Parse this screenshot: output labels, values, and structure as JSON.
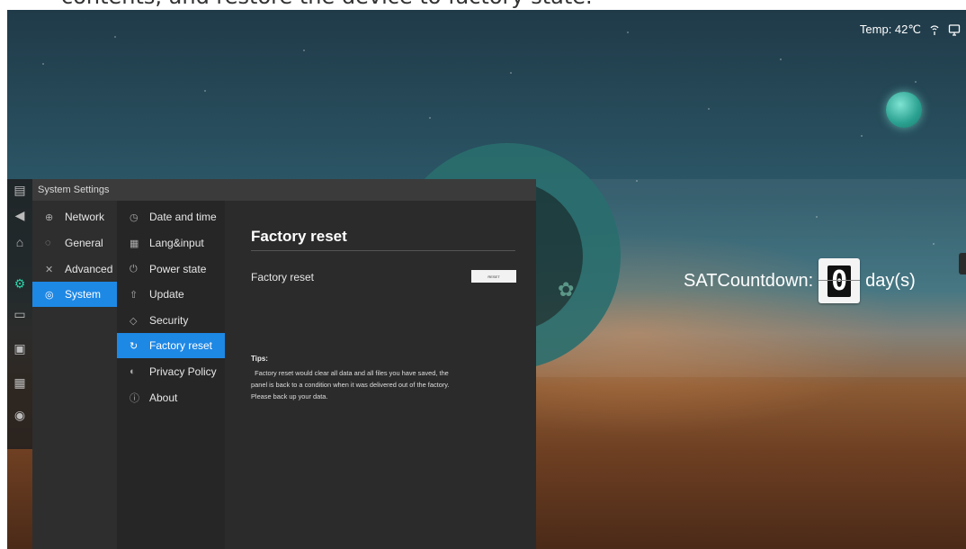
{
  "caption": {
    "text": "contents, and restore the device to factory state."
  },
  "status_bar": {
    "temp_text": "Temp: 42℃"
  },
  "countdown": {
    "label": "SATCountdown:",
    "digit": "0",
    "unit": "day(s)"
  },
  "settings_window": {
    "title": "System Settings",
    "categories": [
      {
        "label": "Network",
        "icon": "globe-icon"
      },
      {
        "label": "General",
        "icon": "palette-icon"
      },
      {
        "label": "Advanced",
        "icon": "tools-icon"
      },
      {
        "label": "System",
        "icon": "system-icon",
        "active": true
      }
    ],
    "subitems": [
      {
        "label": "Date and time",
        "icon": "clock-icon"
      },
      {
        "label": "Lang&input",
        "icon": "keyboard-icon"
      },
      {
        "label": "Power state",
        "icon": "power-icon"
      },
      {
        "label": "Update",
        "icon": "update-icon"
      },
      {
        "label": "Security",
        "icon": "shield-icon"
      },
      {
        "label": "Factory reset",
        "icon": "reset-icon",
        "active": true
      },
      {
        "label": "Privacy Policy",
        "icon": "privacy-icon"
      },
      {
        "label": "About",
        "icon": "info-icon"
      }
    ],
    "content": {
      "title": "Factory reset",
      "row_label": "Factory reset",
      "button_label": "RESET",
      "tips_title": "Tips:",
      "tips_lines": [
        "  Factory reset would clear all data and all files you have saved, the",
        "panel is back to a condition when it was delivered out of the factory.",
        "Please back up your data."
      ]
    }
  },
  "colors": {
    "accent": "#1e88e5",
    "panel_bg": "#2b2b2b",
    "titlebar_bg": "#3b3b3b"
  }
}
